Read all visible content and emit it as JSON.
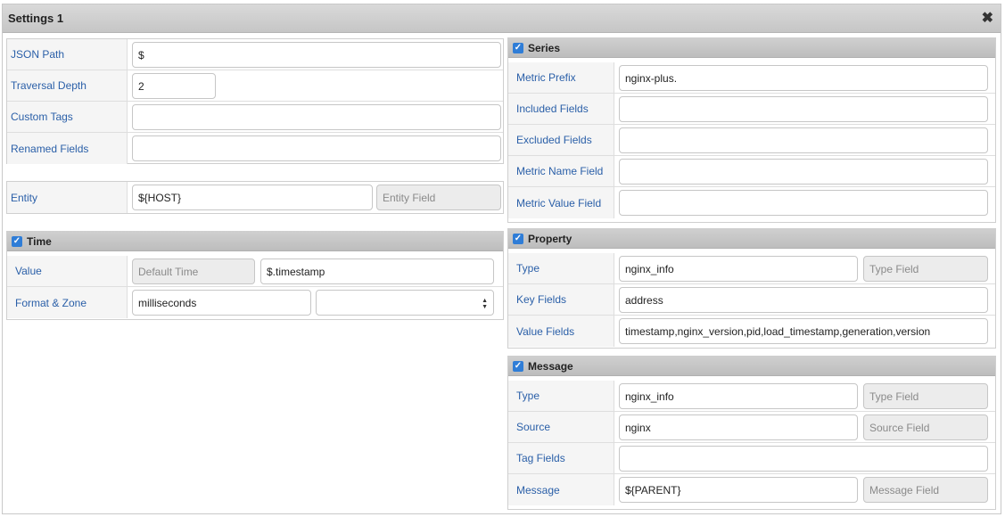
{
  "window": {
    "title": "Settings 1",
    "close_icon": "close-icon"
  },
  "general": {
    "json_path": {
      "label": "JSON Path",
      "value": "$"
    },
    "traversal_depth": {
      "label": "Traversal Depth",
      "value": "2"
    },
    "custom_tags": {
      "label": "Custom Tags",
      "value": ""
    },
    "renamed_fields": {
      "label": "Renamed Fields",
      "value": ""
    }
  },
  "entity": {
    "label": "Entity",
    "value": "${HOST}",
    "field_placeholder": "Entity Field"
  },
  "time": {
    "title": "Time",
    "checked": true,
    "value": {
      "label": "Value",
      "placeholder": "Default Time",
      "value": "$.timestamp"
    },
    "format_zone": {
      "label": "Format & Zone",
      "format": "milliseconds",
      "zone": ""
    }
  },
  "series": {
    "title": "Series",
    "checked": true,
    "metric_prefix": {
      "label": "Metric Prefix",
      "value": "nginx-plus."
    },
    "included_fields": {
      "label": "Included Fields",
      "value": ""
    },
    "excluded_fields": {
      "label": "Excluded Fields",
      "value": ""
    },
    "metric_name_field": {
      "label": "Metric Name Field",
      "value": ""
    },
    "metric_value_field": {
      "label": "Metric Value Field",
      "value": ""
    }
  },
  "property": {
    "title": "Property",
    "checked": true,
    "type": {
      "label": "Type",
      "value": "nginx_info",
      "placeholder": "Type Field"
    },
    "key_fields": {
      "label": "Key Fields",
      "value": "address"
    },
    "value_fields": {
      "label": "Value Fields",
      "value": "timestamp,nginx_version,pid,load_timestamp,generation,version"
    }
  },
  "message": {
    "title": "Message",
    "checked": true,
    "type": {
      "label": "Type",
      "value": "nginx_info",
      "placeholder": "Type Field"
    },
    "source": {
      "label": "Source",
      "value": "nginx",
      "placeholder": "Source Field"
    },
    "tag_fields": {
      "label": "Tag Fields",
      "value": ""
    },
    "message": {
      "label": "Message",
      "value": "${PARENT}",
      "placeholder": "Message Field"
    }
  },
  "colors": {
    "label": "#2a5fa8",
    "checkbox": "#2f7dd7",
    "header": "#c6c6c6"
  }
}
